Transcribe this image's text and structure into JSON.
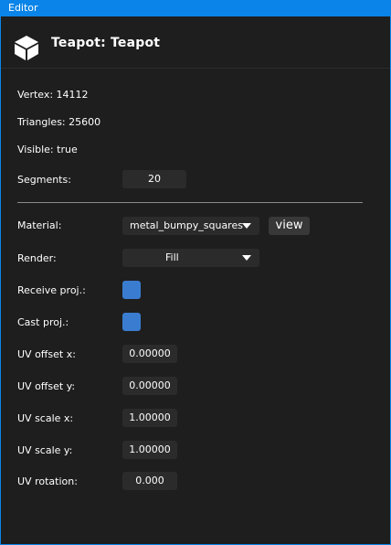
{
  "window": {
    "title": "Editor"
  },
  "header": {
    "title": "Teapot: Teapot",
    "icon": "cube-icon"
  },
  "info": {
    "vertex": "Vertex: 14112",
    "triangles": "Triangles: 25600",
    "visible": "Visible: true"
  },
  "fields": {
    "segments_label": "Segments:",
    "segments_value": "20",
    "material_label": "Material:",
    "material_value": "metal_bumpy_squares",
    "view_label": "view",
    "render_label": "Render:",
    "render_value": "Fill",
    "receive_proj_label": "Receive proj.:",
    "receive_proj_checked": true,
    "cast_proj_label": "Cast proj.:",
    "cast_proj_checked": true,
    "uv_offset_x_label": "UV offset x:",
    "uv_offset_x_value": "0.00000",
    "uv_offset_y_label": "UV offset y:",
    "uv_offset_y_value": "0.00000",
    "uv_scale_x_label": "UV scale x:",
    "uv_scale_x_value": "1.00000",
    "uv_scale_y_label": "UV scale y:",
    "uv_scale_y_value": "1.00000",
    "uv_rotation_label": "UV rotation:",
    "uv_rotation_value": "0.000"
  },
  "colors": {
    "titlebar": "#0a84e8",
    "background": "#1e1e1e",
    "field": "#2b2b2b",
    "checkbox": "#3a7dd0"
  }
}
